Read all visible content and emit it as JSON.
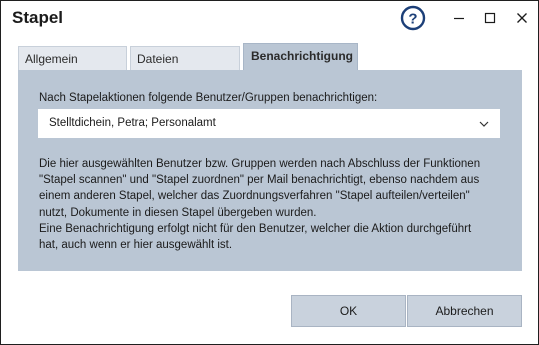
{
  "window": {
    "title": "Stapel"
  },
  "titlebar": {
    "help_icon": "question-circle-icon",
    "minimize_icon": "minimize-icon",
    "maximize_icon": "maximize-icon",
    "close_icon": "close-icon"
  },
  "tabs": [
    {
      "label": "Allgemein",
      "selected": false
    },
    {
      "label": "Dateien",
      "selected": false
    },
    {
      "label": "Benachrichtigung",
      "selected": true
    }
  ],
  "notification": {
    "prompt": "Nach Stapelaktionen folgende Benutzer/Gruppen benachrichtigen:",
    "recipients_value": "Stelltdichein, Petra; Personalamt",
    "description_lines": [
      "Die hier ausgewählten Benutzer bzw. Gruppen werden nach Abschluss der Funktionen",
      "\"Stapel scannen\" und \"Stapel zuordnen\" per Mail benachrichtigt, ebenso nachdem aus",
      "einem anderen Stapel, welcher das Zuordnungsverfahren \"Stapel aufteilen/verteilen\"",
      "nutzt, Dokumente in diesen Stapel übergeben wurden.",
      "Eine Benachrichtigung erfolgt nicht für den Benutzer, welcher die Aktion durchgeführt",
      "hat, auch wenn er hier ausgewählt ist."
    ]
  },
  "buttons": {
    "ok": "OK",
    "cancel": "Abbrechen"
  },
  "colors": {
    "panel_background": "#bac6d4",
    "inactive_tab": "#e4e8ee",
    "button_background": "#c9d2dd",
    "help_icon_color": "#1c3f78"
  }
}
